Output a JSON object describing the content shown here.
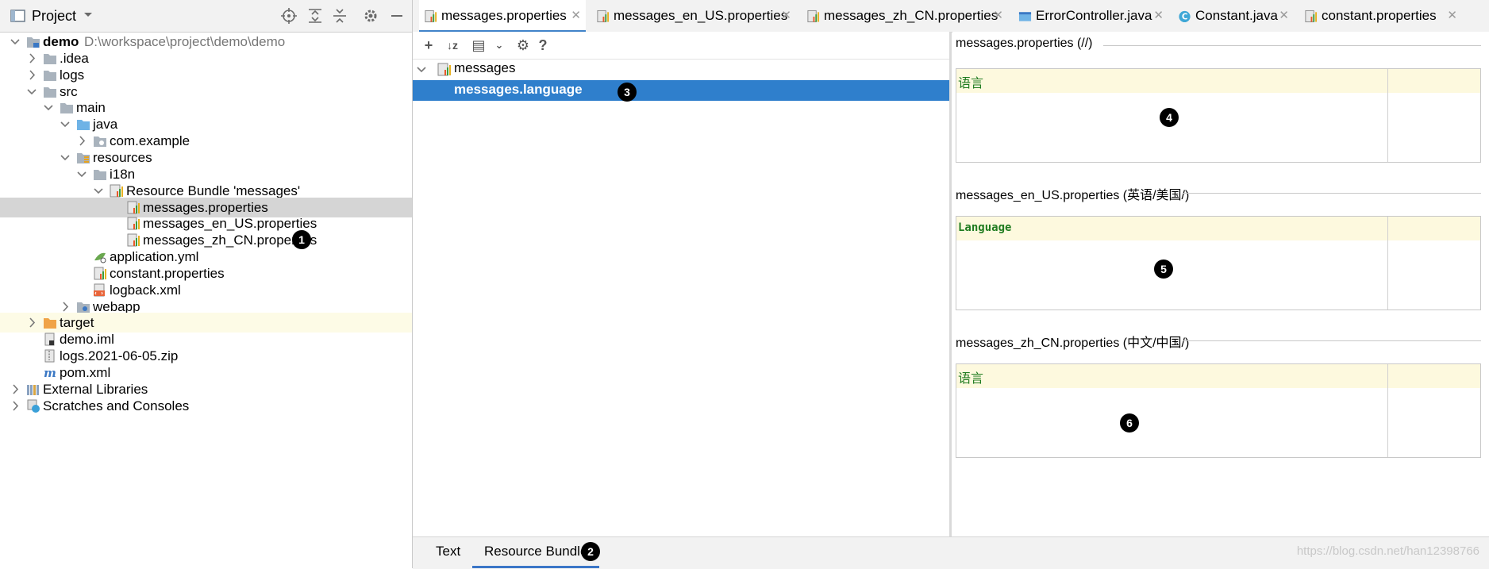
{
  "project_header": {
    "title": "Project"
  },
  "tree": [
    {
      "label": "demo",
      "extra": "D:\\workspace\\project\\demo\\demo",
      "icon": "module-folder-icon",
      "arrow": "expanded",
      "indent": 0,
      "bold": true
    },
    {
      "label": ".idea",
      "icon": "folder-icon",
      "arrow": "collapsed",
      "indent": 1
    },
    {
      "label": "logs",
      "icon": "folder-icon",
      "arrow": "collapsed",
      "indent": 1
    },
    {
      "label": "src",
      "icon": "folder-icon",
      "arrow": "expanded",
      "indent": 1
    },
    {
      "label": "main",
      "icon": "folder-icon",
      "arrow": "expanded",
      "indent": 2
    },
    {
      "label": "java",
      "icon": "source-folder-icon",
      "arrow": "expanded",
      "indent": 3
    },
    {
      "label": "com.example",
      "icon": "package-icon",
      "arrow": "collapsed",
      "indent": 4
    },
    {
      "label": "resources",
      "icon": "resources-folder-icon",
      "arrow": "expanded",
      "indent": 3
    },
    {
      "label": "i18n",
      "icon": "folder-icon",
      "arrow": "expanded",
      "indent": 4
    },
    {
      "label": "Resource Bundle 'messages'",
      "icon": "resource-bundle-icon",
      "arrow": "expanded",
      "indent": 5
    },
    {
      "label": "messages.properties",
      "icon": "properties-file-icon",
      "arrow": "none",
      "indent": 6,
      "selected": true
    },
    {
      "label": "messages_en_US.properties",
      "icon": "properties-file-icon",
      "arrow": "none",
      "indent": 6
    },
    {
      "label": "messages_zh_CN.properties",
      "icon": "properties-file-icon",
      "arrow": "none",
      "indent": 6
    },
    {
      "label": "application.yml",
      "icon": "yaml-file-icon",
      "arrow": "none",
      "indent": 4
    },
    {
      "label": "constant.properties",
      "icon": "properties-file-icon",
      "arrow": "none",
      "indent": 4
    },
    {
      "label": "logback.xml",
      "icon": "xml-file-icon",
      "arrow": "none",
      "indent": 4
    },
    {
      "label": "webapp",
      "icon": "web-folder-icon",
      "arrow": "collapsed",
      "indent": 3
    },
    {
      "label": "target",
      "icon": "excluded-folder-icon",
      "arrow": "collapsed",
      "indent": 1,
      "yellow": true
    },
    {
      "label": "demo.iml",
      "icon": "iml-file-icon",
      "arrow": "none",
      "indent": 1
    },
    {
      "label": "logs.2021-06-05.zip",
      "icon": "zip-file-icon",
      "arrow": "none",
      "indent": 1
    },
    {
      "label": "pom.xml",
      "icon": "maven-file-icon",
      "arrow": "none",
      "indent": 1
    },
    {
      "label": "External Libraries",
      "icon": "libraries-icon",
      "arrow": "collapsed",
      "indent": 0
    },
    {
      "label": "Scratches and Consoles",
      "icon": "scratches-icon",
      "arrow": "collapsed",
      "indent": 0
    }
  ],
  "tabs": [
    {
      "label": "messages.properties",
      "icon": "properties-file-icon",
      "active": true
    },
    {
      "label": "messages_en_US.properties",
      "icon": "properties-file-icon"
    },
    {
      "label": "messages_zh_CN.properties",
      "icon": "properties-file-icon"
    },
    {
      "label": "ErrorController.java",
      "icon": "java-file-icon"
    },
    {
      "label": "Constant.java",
      "icon": "class-icon"
    },
    {
      "label": "constant.properties",
      "icon": "properties-file-icon"
    }
  ],
  "toolbar": {
    "add": "+",
    "sort": "↓z",
    "group": "▤",
    "dropdown": "⌄",
    "settings": "⚙",
    "help": "?"
  },
  "bundle": {
    "root": "messages",
    "selected_key": "messages.language"
  },
  "sections": [
    {
      "title": "messages.properties (//)",
      "value": "语言",
      "mono": false
    },
    {
      "title": "messages_en_US.properties (英语/美国/)",
      "value": "Language",
      "mono": true
    },
    {
      "title": "messages_zh_CN.properties (中文/中国/)",
      "value": "语言",
      "mono": false
    }
  ],
  "bottom_tabs": [
    {
      "label": "Text"
    },
    {
      "label": "Resource Bundle",
      "active": true
    }
  ],
  "markers": [
    "1",
    "2",
    "3",
    "4",
    "5",
    "6"
  ],
  "watermark": "https://blog.csdn.net/han12398766",
  "colors": {
    "selection_blue": "#2f7fcc",
    "selected_row_gray": "#d5d5d5",
    "value_green": "#207c20",
    "highlight_yellow": "#fdf9de"
  }
}
